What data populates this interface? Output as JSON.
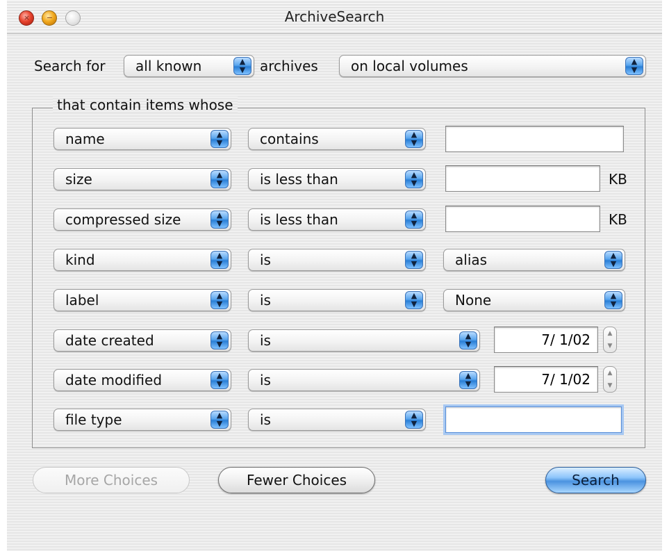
{
  "window": {
    "title": "ArchiveSearch"
  },
  "search_bar": {
    "prefix_label": "Search for",
    "archive_scope": "all known",
    "middle_label": "archives",
    "volume_scope": "on local volumes"
  },
  "criteria": {
    "legend": "that contain items whose",
    "unit_kb": "KB",
    "rows": [
      {
        "attribute": "name",
        "operator": "contains",
        "value_type": "text",
        "value": ""
      },
      {
        "attribute": "size",
        "operator": "is less than",
        "value_type": "text",
        "value": "",
        "unit": "KB"
      },
      {
        "attribute": "compressed size",
        "operator": "is less than",
        "value_type": "text",
        "value": "",
        "unit": "KB"
      },
      {
        "attribute": "kind",
        "operator": "is",
        "value_type": "popup",
        "value": "alias"
      },
      {
        "attribute": "label",
        "operator": "is",
        "value_type": "popup",
        "value": "None"
      },
      {
        "attribute": "date created",
        "operator": "is",
        "value_type": "date",
        "value": "7/ 1/02"
      },
      {
        "attribute": "date modified",
        "operator": "is",
        "value_type": "date",
        "value": "7/ 1/02"
      },
      {
        "attribute": "file type",
        "operator": "is",
        "value_type": "text",
        "value": "",
        "focused": true
      }
    ]
  },
  "buttons": {
    "more_choices": "More Choices",
    "fewer_choices": "Fewer Choices",
    "search": "Search"
  },
  "icons": {
    "close": "close-icon",
    "minimize": "minimize-icon",
    "zoom": "zoom-icon",
    "popup_arrows": "up-down-arrows-icon",
    "stepper": "stepper-arrows-icon"
  },
  "colors": {
    "accent": "#4b93e0",
    "close": "#e8442e",
    "minimize": "#f2aa1f",
    "focus_ring": "#a7c8f2"
  }
}
